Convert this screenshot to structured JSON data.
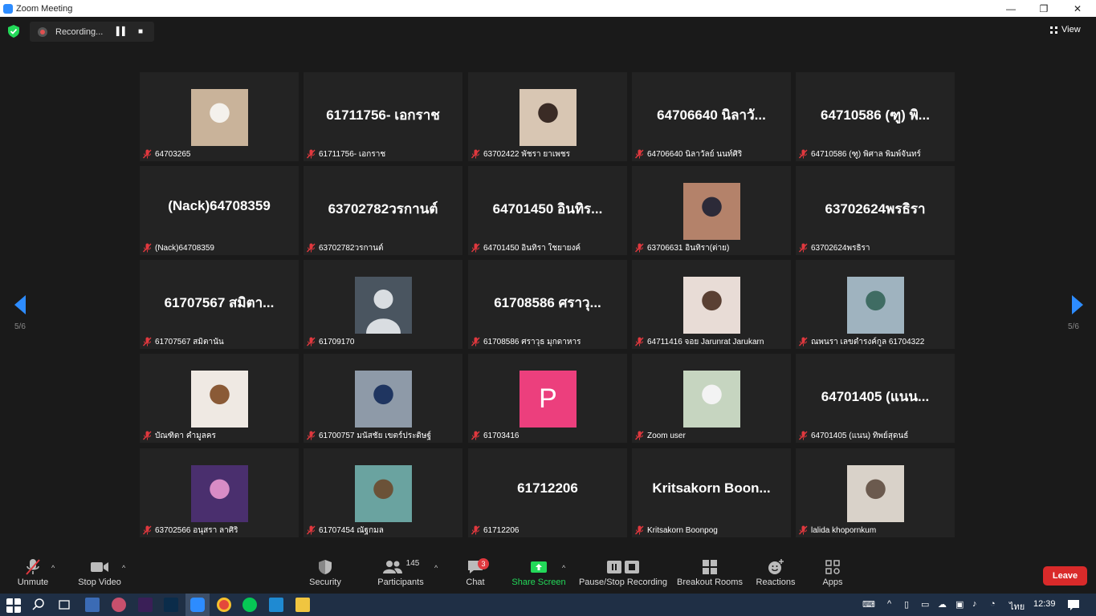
{
  "window": {
    "title": "Zoom Meeting",
    "minimize": "—",
    "maximize": "❐",
    "close": "✕"
  },
  "topbar": {
    "recording_label": "Recording...",
    "pause_icon": "pause-icon",
    "stop_icon": "stop-icon",
    "view_label": "View"
  },
  "pagination": {
    "left": "5/6",
    "right": "5/6"
  },
  "tiles": [
    {
      "label": "64703265",
      "type": "photo",
      "photo_color": "#c9b39a",
      "accent": "#f4f1ec"
    },
    {
      "label": "61711756- เอกราช",
      "type": "name",
      "display": "61711756- เอกราช"
    },
    {
      "label": "63702422 พัชรา ยาเพชร",
      "type": "photo",
      "photo_color": "#d8c6b3",
      "accent": "#3a2b25"
    },
    {
      "label": "64706640 นิลาวัลย์ นนท์ศิริ",
      "type": "name",
      "display": "64706640 นิลาวั..."
    },
    {
      "label": "64710586 (ฑู) พิศาล พิมพ์จันทร์",
      "type": "name",
      "display": "64710586 (ฑู) พิ..."
    },
    {
      "label": "(Nack)64708359",
      "type": "name",
      "display": "(Nack)64708359"
    },
    {
      "label": "63702782วรกานต์",
      "type": "name",
      "display": "63702782วรกานต์"
    },
    {
      "label": "64701450 อินทิรา ใชยายงค์",
      "type": "name",
      "display": "64701450 อินทิร..."
    },
    {
      "label": "63706631 อินทิรา(ต่าย)",
      "type": "photo",
      "photo_color": "#b4826a",
      "accent": "#2c2a38"
    },
    {
      "label": "63702624พรธิรา",
      "type": "name",
      "display": "63702624พรธิรา"
    },
    {
      "label": "61707567 สมิตานัน",
      "type": "name",
      "display": "61707567 สมิตา..."
    },
    {
      "label": "61709170",
      "type": "avatar"
    },
    {
      "label": "61708586 ศราวุธ มุกดาหาร",
      "type": "name",
      "display": "61708586 ศราวุ..."
    },
    {
      "label": "64711416 จอย Jarunrat Jarukarn",
      "type": "photo",
      "photo_color": "#e8dcd6",
      "accent": "#5a4033"
    },
    {
      "label": "ณพนรา เลขดำรงค์กูล 61704322",
      "type": "photo",
      "photo_color": "#9fb3bf",
      "accent": "#3f6c63"
    },
    {
      "label": "บัณฑิตา คำมูลคร",
      "type": "photo",
      "photo_color": "#efe9e3",
      "accent": "#8a5a36"
    },
    {
      "label": "61700757 มนัสชัย เขตร์ประดิษฐ์",
      "type": "photo",
      "photo_color": "#8e9aa8",
      "accent": "#1f3560"
    },
    {
      "label": "61703416",
      "type": "letter",
      "letter": "P",
      "letter_color": "#ec3f7d"
    },
    {
      "label": "Zoom user",
      "type": "photo",
      "photo_color": "#c6d5c0",
      "accent": "#f3f3f3"
    },
    {
      "label": "64701405 (แนน) ทิพย์สุดนธ์",
      "type": "name",
      "display": "64701405 (แนน..."
    },
    {
      "label": "63702566 อนุสรา ลาศิริ",
      "type": "photo",
      "photo_color": "#4a2f6e",
      "accent": "#d88cc6"
    },
    {
      "label": "61707454 ณัฐกมล",
      "type": "photo",
      "photo_color": "#6aa3a0",
      "accent": "#6b5238"
    },
    {
      "label": "61712206",
      "type": "name",
      "display": "61712206"
    },
    {
      "label": "Kritsakorn Boonpog",
      "type": "name",
      "display": "Kritsakorn Boon..."
    },
    {
      "label": "lalida khopornkum",
      "type": "photo",
      "photo_color": "#d9d2c9",
      "accent": "#6b5a4e"
    }
  ],
  "toolbar": {
    "unmute": "Unmute",
    "stop_video": "Stop Video",
    "security": "Security",
    "participants": "Participants",
    "participants_count": "145",
    "chat": "Chat",
    "chat_badge": "3",
    "share_screen": "Share Screen",
    "pause_stop_recording": "Pause/Stop Recording",
    "breakout_rooms": "Breakout Rooms",
    "reactions": "Reactions",
    "apps": "Apps",
    "leave": "Leave"
  },
  "taskbar": {
    "language": "ไทย",
    "time": "12:39"
  },
  "colors": {
    "share_green": "#23d959",
    "leave_red": "#d92a2a",
    "badge_red": "#e0383e"
  }
}
